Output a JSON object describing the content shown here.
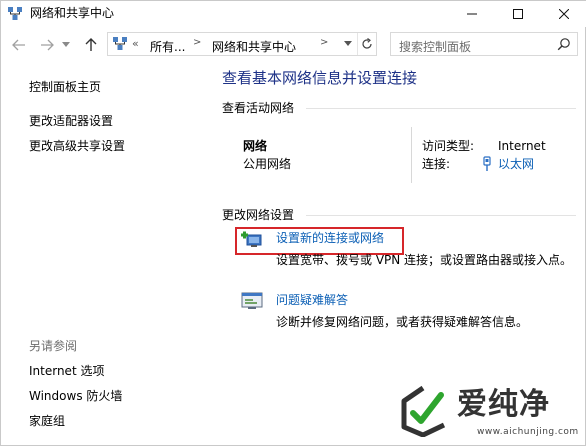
{
  "window": {
    "title": "网络和共享中心"
  },
  "navbar": {
    "chevron": "«",
    "crumbs": [
      "所有...",
      "网络和共享中心"
    ],
    "search_placeholder": "搜索控制面板"
  },
  "sidebar": {
    "links": [
      "控制面板主页",
      "更改适配器设置",
      "更改高级共享设置"
    ],
    "see_also_heading": "另请参阅",
    "see_also": [
      "Internet 选项",
      "Windows 防火墙",
      "家庭组"
    ]
  },
  "main": {
    "title": "查看基本网络信息并设置连接",
    "active_networks_label": "查看活动网络",
    "network": {
      "name": "网络",
      "category": "公用网络",
      "access_type_label": "访问类型:",
      "access_type_value": "Internet",
      "connections_label": "连接:",
      "connections_value": "以太网"
    },
    "change_settings_label": "更改网络设置",
    "tasks": [
      {
        "icon": "network-add-icon",
        "link": "设置新的连接或网络",
        "description": "设置宽带、拨号或 VPN 连接；或设置路由器或接入点。"
      },
      {
        "icon": "troubleshoot-icon",
        "link": "问题疑难解答",
        "description": "诊断并修复网络问题，或者获得疑难解答信息。"
      }
    ]
  },
  "watermark": {
    "brand": "爱纯净",
    "url": "www.aichunjing.com"
  },
  "colors": {
    "link": "#0b5fb5",
    "title": "#1e3287",
    "highlight": "#d6262a"
  }
}
